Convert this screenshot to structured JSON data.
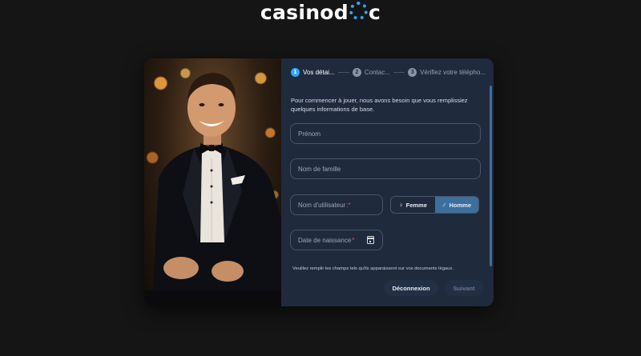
{
  "brand": {
    "logo_pre": "casinod",
    "logo_post": "c"
  },
  "steps": [
    {
      "num": "1",
      "label": "Vos détai...",
      "active": true
    },
    {
      "num": "2",
      "label": "Contac...",
      "active": false
    },
    {
      "num": "3",
      "label": "Vérifiez votre télépho...",
      "active": false
    }
  ],
  "intro_text": "Pour commencer à jouer, nous avons besoin que vous remplissiez quelques informations de base.",
  "fields": {
    "first_name": {
      "placeholder": "Prénom"
    },
    "last_name": {
      "placeholder": "Nom de famille"
    },
    "username": {
      "placeholder": "Nom d'utilisateur",
      "required_mark": ":*"
    },
    "birthdate": {
      "placeholder": "Date de naissance",
      "required_mark": "*"
    }
  },
  "gender": {
    "female_symbol": "♀",
    "female_label": "Femme",
    "male_symbol": "♂",
    "male_label": "Homme",
    "selected": "Homme"
  },
  "note": "Veuillez remplir les champs tels qu'ils apparaissent sur vos documents légaux.",
  "buttons": {
    "logout": "Déconnexion",
    "next": "Suivant"
  },
  "colors": {
    "accent": "#2ea6ff",
    "selected_toggle": "#3b6f9e",
    "panel": "#1f2a3d",
    "background": "#151515"
  }
}
